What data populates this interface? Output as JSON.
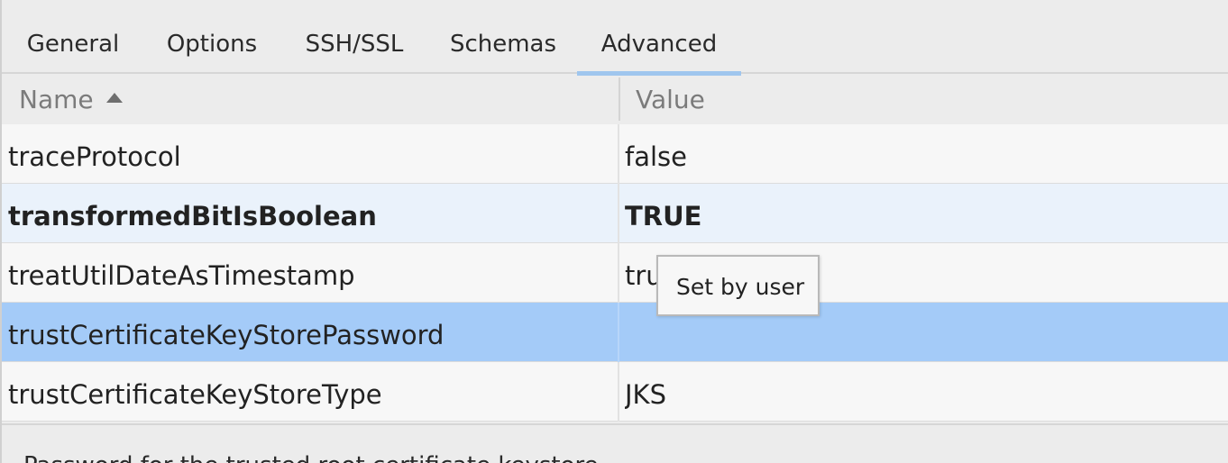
{
  "tabs": [
    {
      "label": "General",
      "active": false
    },
    {
      "label": "Options",
      "active": false
    },
    {
      "label": "SSH/SSL",
      "active": false
    },
    {
      "label": "Schemas",
      "active": false
    },
    {
      "label": "Advanced",
      "active": true
    }
  ],
  "table": {
    "columns": {
      "name": "Name",
      "value": "Value"
    },
    "sort": {
      "column": "Name",
      "direction": "ascending"
    },
    "rows": [
      {
        "name": "traceProtocol",
        "value": "false",
        "state": "default"
      },
      {
        "name": "transformedBitIsBoolean",
        "value": "TRUE",
        "state": "modified"
      },
      {
        "name": "treatUtilDateAsTimestamp",
        "value": "tru",
        "state": "default"
      },
      {
        "name": "trustCertificateKeyStorePassword",
        "value": "",
        "state": "selected"
      },
      {
        "name": "trustCertificateKeyStoreType",
        "value": "JKS",
        "state": "default"
      }
    ]
  },
  "tooltip": {
    "text": "Set by user"
  },
  "description": {
    "text": "Password for the trusted root certificate keystore"
  },
  "colors": {
    "active_tab_underline": "#9fc6ee",
    "selected_row": "#a4cbf8",
    "modified_row": "#eaf2fb"
  }
}
